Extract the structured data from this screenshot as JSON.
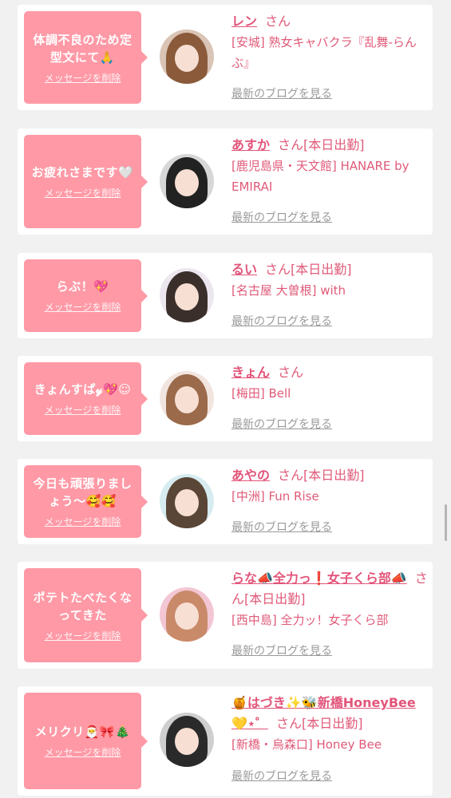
{
  "delete_label": "メッセージを削除",
  "blog_label": "最新のブログを見る",
  "accent_color": "#ff99a6",
  "name_color": "#e2557a",
  "entries": [
    {
      "message": "体調不良のため定型文にて🙏",
      "name": "レン",
      "suffix": "さん",
      "shop": "[安城] 熟女キャバクラ『乱舞-らんぶ』"
    },
    {
      "message": "お疲れさまです🤍",
      "name": "あすか",
      "suffix": "さん[本日出勤]",
      "shop": "[鹿児島県・天文館] HANARE by EMIRAI"
    },
    {
      "message": "らぶ！💖",
      "name": "るい",
      "suffix": "さん[本日出勤]",
      "shop": "[名古屋 大曽根] with"
    },
    {
      "message": "きょんすぱ𝓎💖☺",
      "name": "きょん",
      "suffix": "さん",
      "shop": "[梅田] Bell"
    },
    {
      "message": "今日も頑張りましょう〜🥰🥰",
      "name": "あやの",
      "suffix": "さん[本日出勤]",
      "shop": "[中洲] Fun Rise"
    },
    {
      "message": "ポテトたべたくなってきた",
      "name": "らな📣全力っ❗女子くら部📣",
      "suffix": "さん[本日出勤]",
      "shop": "[西中島] 全力ッ！女子くら部"
    },
    {
      "message": "メリクリ🎅🎀🎄",
      "name": "🍯はづき✨🐝新橋HoneyBee💛⋆゜",
      "suffix": "さん[本日出勤]",
      "shop": "[新橋・烏森口] Honey Bee"
    }
  ]
}
